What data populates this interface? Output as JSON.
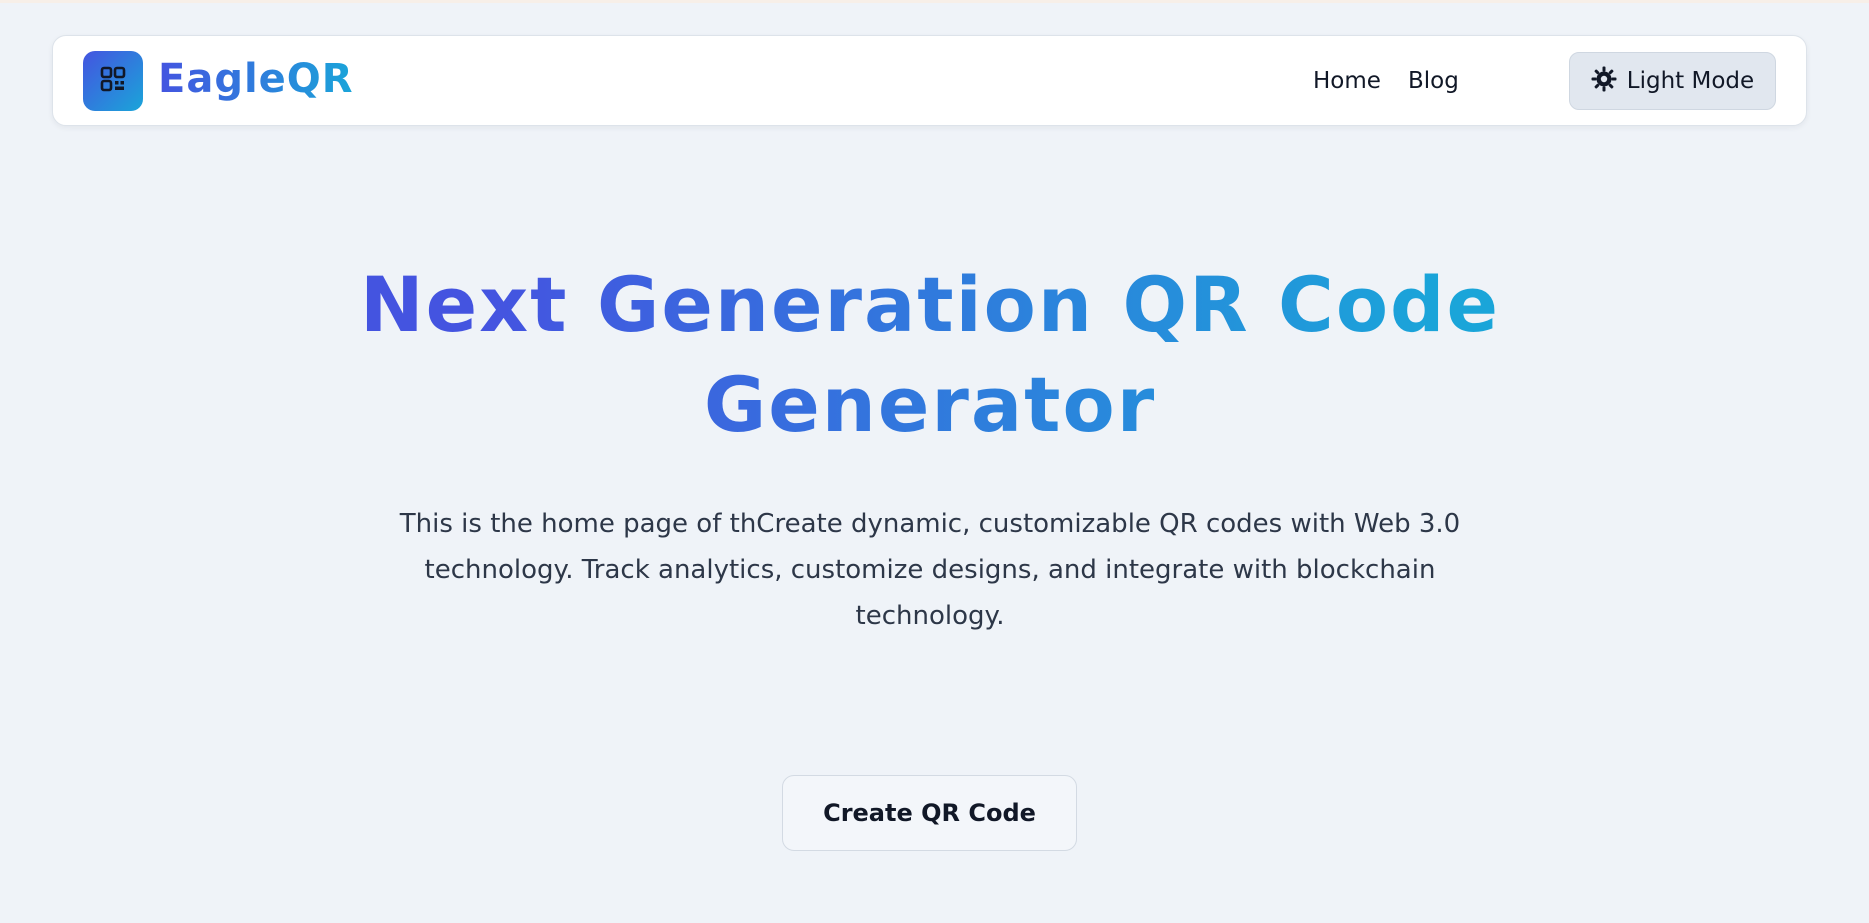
{
  "brand": {
    "name": "EagleQR",
    "logo_icon": "qr-code-icon",
    "gradient_start": "#4454e0",
    "gradient_end": "#1aa5d9"
  },
  "nav": {
    "links": [
      {
        "label": "Home"
      },
      {
        "label": "Blog"
      }
    ],
    "mode_toggle": {
      "label": "Light Mode",
      "icon": "sun-icon"
    }
  },
  "hero": {
    "title": "Next Generation QR Code Generator",
    "description": "This is the home page of thCreate dynamic, customizable QR codes with Web 3.0 technology. Track analytics, customize designs, and integrate with blockchain technology.",
    "cta_label": "Create QR Code"
  },
  "colors": {
    "page_background": "#eff3f8",
    "navbar_background": "#ffffff",
    "toggle_background": "#e1e7ef",
    "text": "#111827"
  }
}
